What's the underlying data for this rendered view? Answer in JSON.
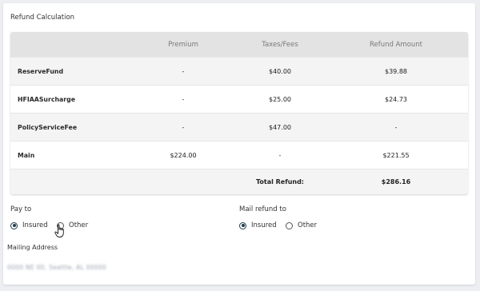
{
  "section_title": "Refund Calculation",
  "table": {
    "headers": [
      "",
      "Premium",
      "Taxes/Fees",
      "Refund Amount"
    ],
    "rows": [
      {
        "label": "ReserveFund",
        "premium": "-",
        "taxes": "$40.00",
        "refund": "$39.88"
      },
      {
        "label": "HFIAASurcharge",
        "premium": "-",
        "taxes": "$25.00",
        "refund": "$24.73"
      },
      {
        "label": "PolicyServiceFee",
        "premium": "-",
        "taxes": "$47.00",
        "refund": "-"
      },
      {
        "label": "Main",
        "premium": "$224.00",
        "taxes": "-",
        "refund": "$221.55"
      }
    ],
    "total_label": "Total Refund:",
    "total_value": "$286.16"
  },
  "pay_to": {
    "title": "Pay to",
    "options": [
      "Insured",
      "Other"
    ],
    "selected": "Insured"
  },
  "mail_refund_to": {
    "title": "Mail refund to",
    "options": [
      "Insured",
      "Other"
    ],
    "selected": "Insured"
  },
  "mailing_address": {
    "title": "Mailing Address",
    "value": "0000 NE 00, Seattle, AL 00000"
  },
  "colors": {
    "accent": "#1f3b4d",
    "header_bg": "#e3e3e3",
    "row_shade": "#f4f4f4"
  }
}
